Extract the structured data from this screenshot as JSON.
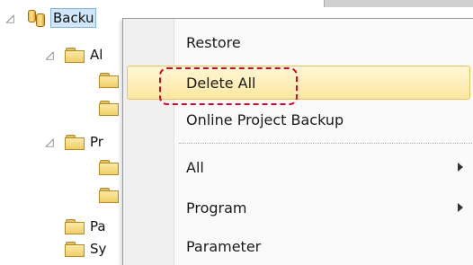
{
  "tree": {
    "root": {
      "label": "Backu",
      "expanded": true
    },
    "nodes": [
      {
        "label": "Al",
        "expanded": true
      },
      {
        "label": ""
      },
      {
        "label": ""
      },
      {
        "label": "Pr",
        "expanded": true
      },
      {
        "label": ""
      },
      {
        "label": ""
      },
      {
        "label": "Pa"
      },
      {
        "label": "Sy"
      }
    ]
  },
  "context_menu": {
    "items": [
      {
        "label": "Restore"
      },
      {
        "label": "Delete All",
        "highlighted": true
      },
      {
        "label": "Online Project Backup"
      },
      {
        "label": "All",
        "submenu": true
      },
      {
        "label": "Program",
        "submenu": true
      },
      {
        "label": "Parameter"
      }
    ]
  },
  "colors": {
    "highlight": "#fde7a0",
    "focus_outline": "#d8002a",
    "selection": "#cfe6fb"
  },
  "icons": {
    "expander": "collapse-triangle-icon",
    "folder": "folder-icon",
    "root": "database-backup-icon",
    "submenu": "submenu-arrow-icon"
  }
}
